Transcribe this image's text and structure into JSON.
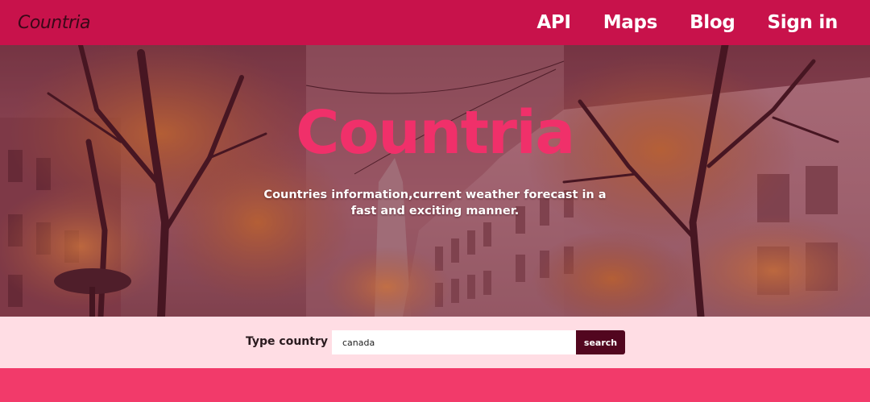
{
  "navbar": {
    "brand": "Countria",
    "links": [
      "API",
      "Maps",
      "Blog",
      "Sign in"
    ]
  },
  "hero": {
    "title": "Countria",
    "subtitle": "Countries information,current weather forecast in a fast and exciting manner."
  },
  "search": {
    "label": "Type country ...",
    "value": "canada",
    "button_label": "search"
  },
  "colors": {
    "navbar": "#c8124b",
    "title": "#f0306a",
    "search_button": "#52061f",
    "search_bar": "#ffdde4",
    "footer": "#f23a6a"
  }
}
